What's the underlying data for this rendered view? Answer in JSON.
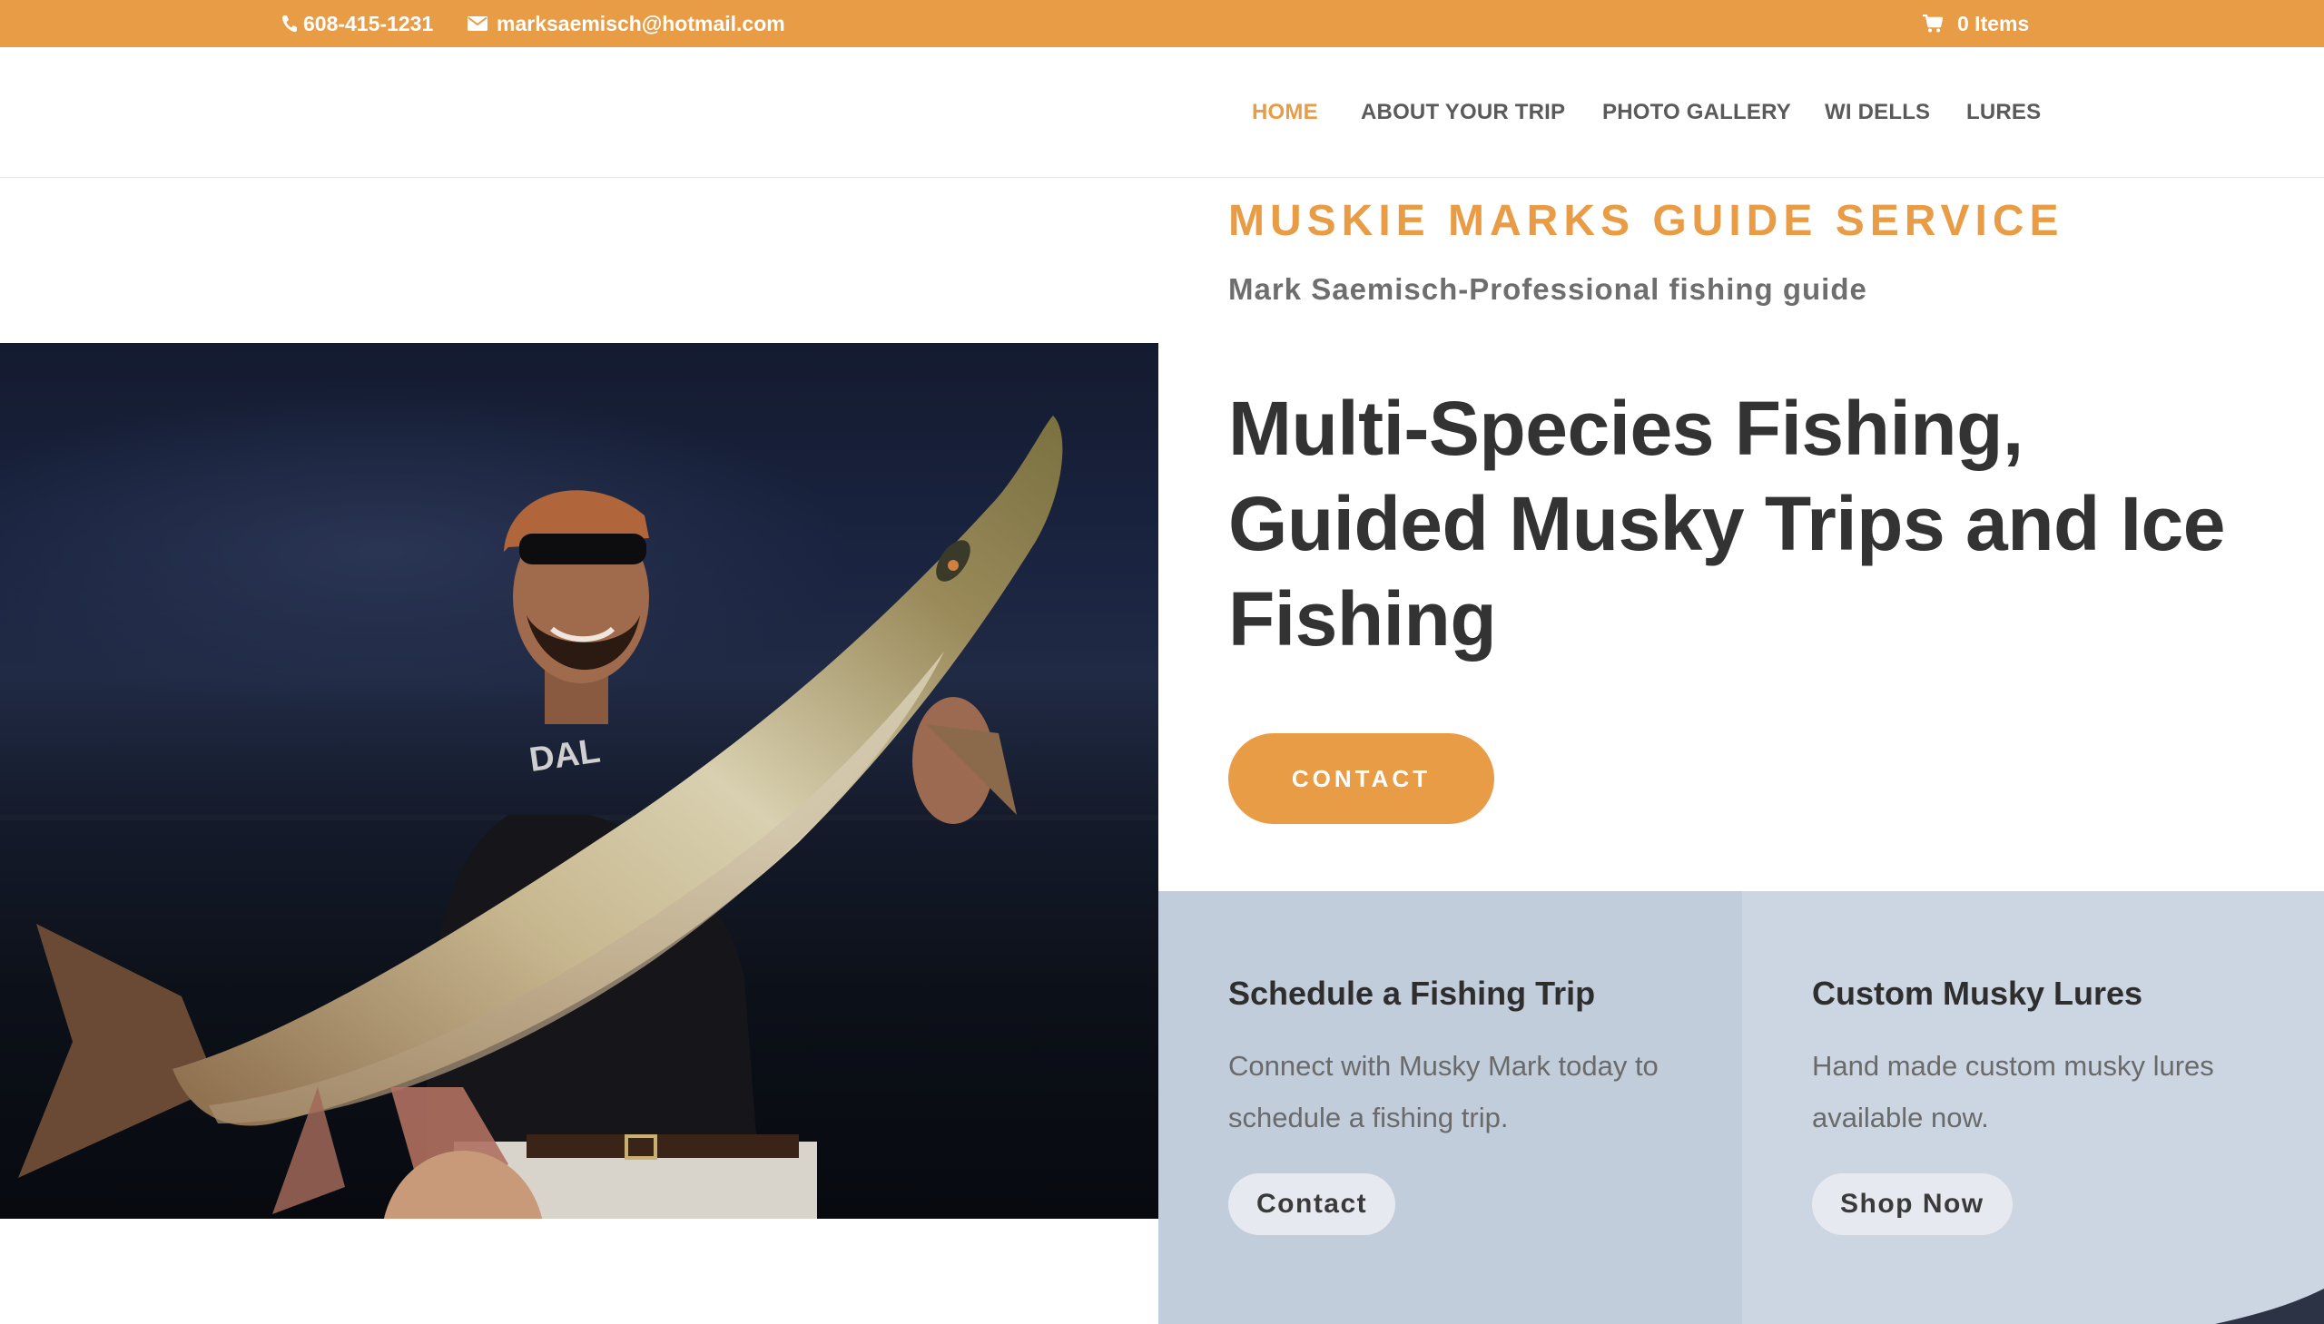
{
  "topbar": {
    "phone": "608-415-1231",
    "email": "marksaemisch@hotmail.com",
    "cart": "0 Items",
    "icons": [
      "phone-icon",
      "mail-icon",
      "cart-icon"
    ]
  },
  "nav": {
    "items": [
      {
        "label": "HOME",
        "active": true
      },
      {
        "label": "ABOUT YOUR TRIP",
        "active": false
      },
      {
        "label": "PHOTO GALLERY",
        "active": false
      },
      {
        "label": "WI DELLS",
        "active": false
      },
      {
        "label": "LURES",
        "active": false
      }
    ]
  },
  "hero": {
    "site_title": "MUSKIE MARKS GUIDE SERVICE",
    "site_subtitle": "Mark Saemisch-Professional fishing guide",
    "headline": "Multi-Species Fishing, Guided Musky Trips and Ice Fishing",
    "cta_label": "CONTACT",
    "photo_shirt_text": "DAL"
  },
  "features": [
    {
      "title": "Schedule a Fishing Trip",
      "text": "Connect with Musky Mark today to schedule a fishing trip.",
      "button": "Contact"
    },
    {
      "title": "Custom Musky Lures",
      "text": "Hand made custom musky lures available now.",
      "button": "Shop Now"
    }
  ],
  "colors": {
    "accent": "#e89c46",
    "feature_left_bg": "#c2cddb",
    "feature_right_bg": "#ccd6e3",
    "heading": "#333333",
    "nav_text": "#5a5a5a"
  }
}
